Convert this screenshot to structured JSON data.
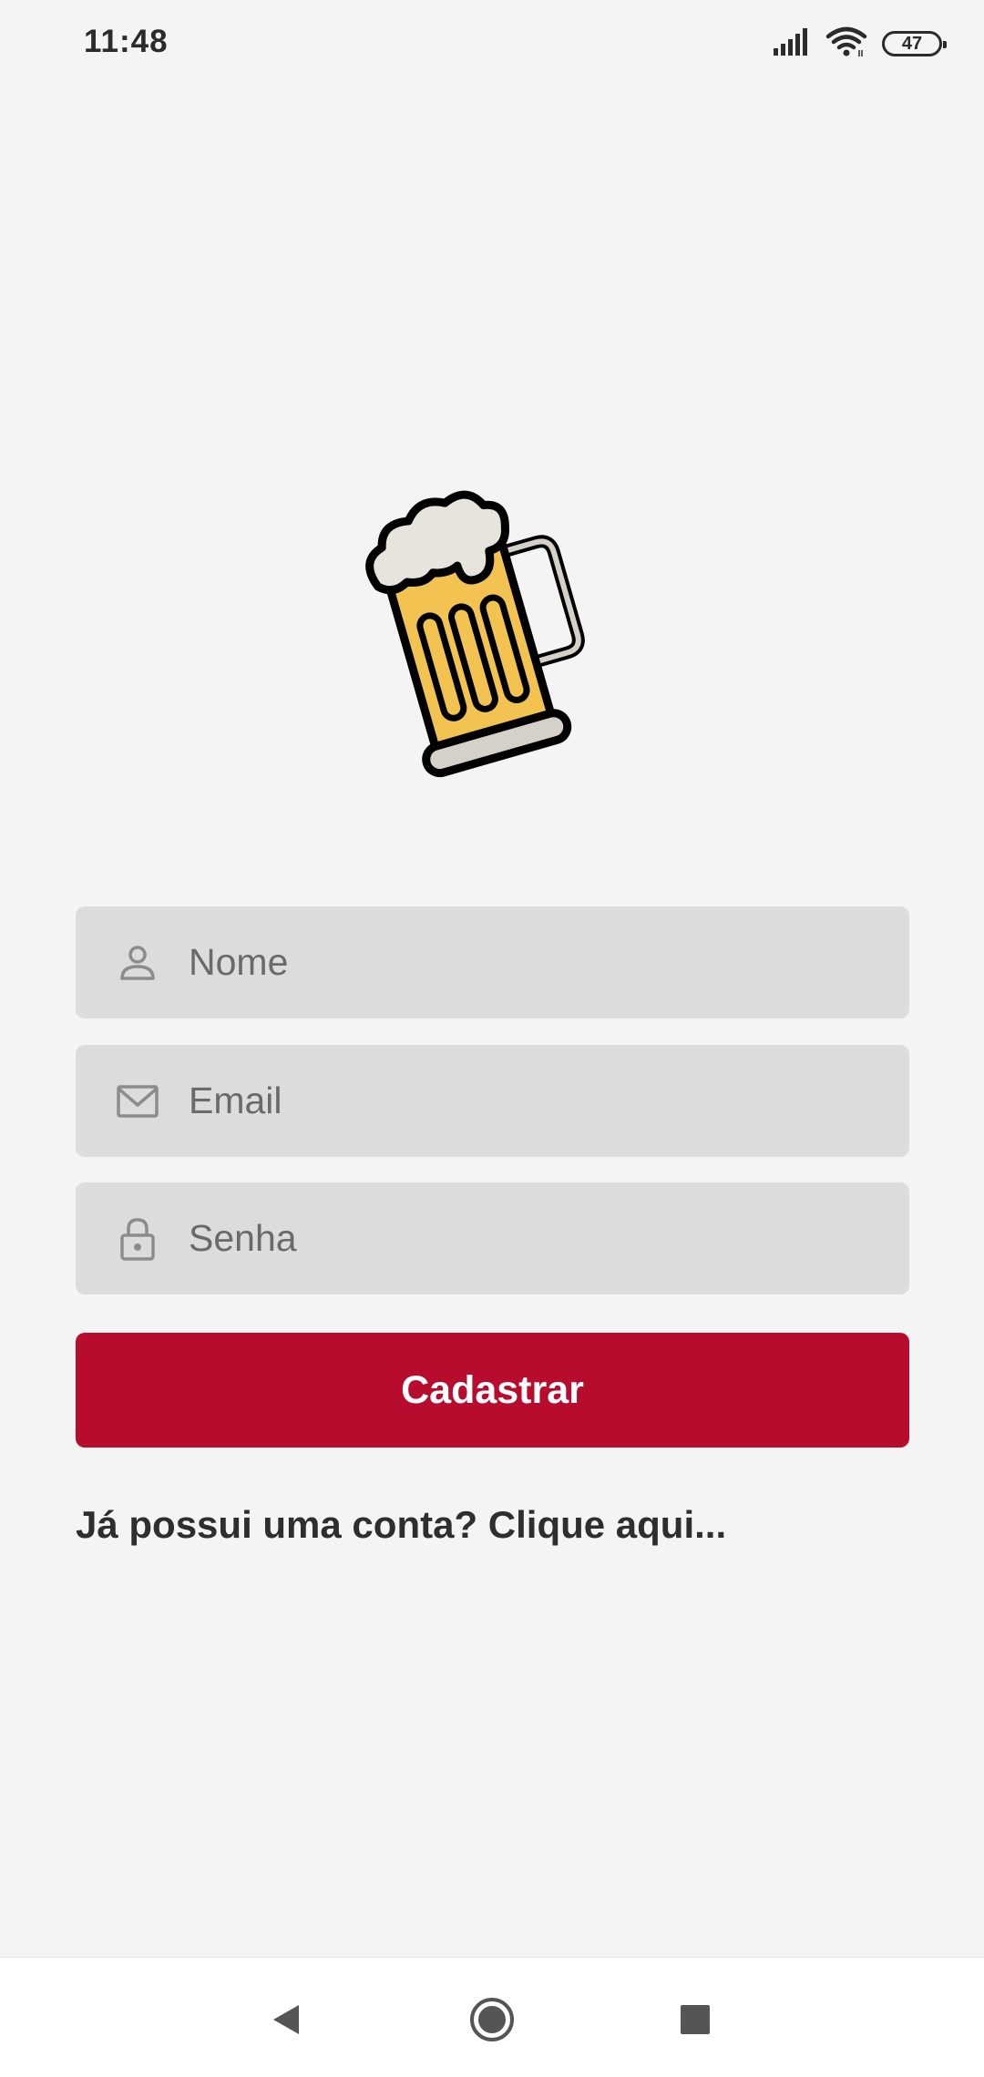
{
  "status_bar": {
    "time": "11:48",
    "battery_level": "47"
  },
  "logo": {
    "icon": "beer-mug-icon"
  },
  "form": {
    "name_placeholder": "Nome",
    "email_placeholder": "Email",
    "password_placeholder": "Senha",
    "submit_label": "Cadastrar"
  },
  "login_link": "Já possui uma conta? Clique aqui...",
  "colors": {
    "accent": "#b80c2e",
    "background": "#f4f4f4",
    "field_background": "#dcdcdc"
  }
}
